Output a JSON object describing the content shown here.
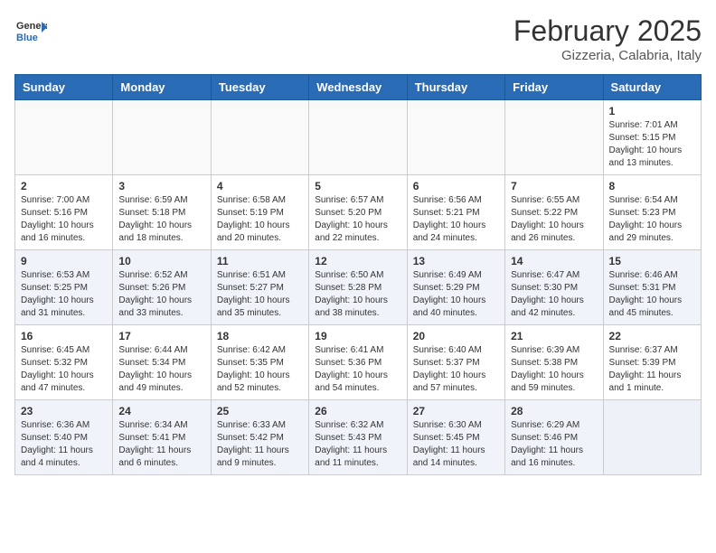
{
  "header": {
    "logo_general": "General",
    "logo_blue": "Blue",
    "month_year": "February 2025",
    "location": "Gizzeria, Calabria, Italy"
  },
  "weekdays": [
    "Sunday",
    "Monday",
    "Tuesday",
    "Wednesday",
    "Thursday",
    "Friday",
    "Saturday"
  ],
  "weeks": [
    {
      "shaded": false,
      "days": [
        {
          "num": "",
          "info": ""
        },
        {
          "num": "",
          "info": ""
        },
        {
          "num": "",
          "info": ""
        },
        {
          "num": "",
          "info": ""
        },
        {
          "num": "",
          "info": ""
        },
        {
          "num": "",
          "info": ""
        },
        {
          "num": "1",
          "info": "Sunrise: 7:01 AM\nSunset: 5:15 PM\nDaylight: 10 hours\nand 13 minutes."
        }
      ]
    },
    {
      "shaded": false,
      "days": [
        {
          "num": "2",
          "info": "Sunrise: 7:00 AM\nSunset: 5:16 PM\nDaylight: 10 hours\nand 16 minutes."
        },
        {
          "num": "3",
          "info": "Sunrise: 6:59 AM\nSunset: 5:18 PM\nDaylight: 10 hours\nand 18 minutes."
        },
        {
          "num": "4",
          "info": "Sunrise: 6:58 AM\nSunset: 5:19 PM\nDaylight: 10 hours\nand 20 minutes."
        },
        {
          "num": "5",
          "info": "Sunrise: 6:57 AM\nSunset: 5:20 PM\nDaylight: 10 hours\nand 22 minutes."
        },
        {
          "num": "6",
          "info": "Sunrise: 6:56 AM\nSunset: 5:21 PM\nDaylight: 10 hours\nand 24 minutes."
        },
        {
          "num": "7",
          "info": "Sunrise: 6:55 AM\nSunset: 5:22 PM\nDaylight: 10 hours\nand 26 minutes."
        },
        {
          "num": "8",
          "info": "Sunrise: 6:54 AM\nSunset: 5:23 PM\nDaylight: 10 hours\nand 29 minutes."
        }
      ]
    },
    {
      "shaded": true,
      "days": [
        {
          "num": "9",
          "info": "Sunrise: 6:53 AM\nSunset: 5:25 PM\nDaylight: 10 hours\nand 31 minutes."
        },
        {
          "num": "10",
          "info": "Sunrise: 6:52 AM\nSunset: 5:26 PM\nDaylight: 10 hours\nand 33 minutes."
        },
        {
          "num": "11",
          "info": "Sunrise: 6:51 AM\nSunset: 5:27 PM\nDaylight: 10 hours\nand 35 minutes."
        },
        {
          "num": "12",
          "info": "Sunrise: 6:50 AM\nSunset: 5:28 PM\nDaylight: 10 hours\nand 38 minutes."
        },
        {
          "num": "13",
          "info": "Sunrise: 6:49 AM\nSunset: 5:29 PM\nDaylight: 10 hours\nand 40 minutes."
        },
        {
          "num": "14",
          "info": "Sunrise: 6:47 AM\nSunset: 5:30 PM\nDaylight: 10 hours\nand 42 minutes."
        },
        {
          "num": "15",
          "info": "Sunrise: 6:46 AM\nSunset: 5:31 PM\nDaylight: 10 hours\nand 45 minutes."
        }
      ]
    },
    {
      "shaded": false,
      "days": [
        {
          "num": "16",
          "info": "Sunrise: 6:45 AM\nSunset: 5:32 PM\nDaylight: 10 hours\nand 47 minutes."
        },
        {
          "num": "17",
          "info": "Sunrise: 6:44 AM\nSunset: 5:34 PM\nDaylight: 10 hours\nand 49 minutes."
        },
        {
          "num": "18",
          "info": "Sunrise: 6:42 AM\nSunset: 5:35 PM\nDaylight: 10 hours\nand 52 minutes."
        },
        {
          "num": "19",
          "info": "Sunrise: 6:41 AM\nSunset: 5:36 PM\nDaylight: 10 hours\nand 54 minutes."
        },
        {
          "num": "20",
          "info": "Sunrise: 6:40 AM\nSunset: 5:37 PM\nDaylight: 10 hours\nand 57 minutes."
        },
        {
          "num": "21",
          "info": "Sunrise: 6:39 AM\nSunset: 5:38 PM\nDaylight: 10 hours\nand 59 minutes."
        },
        {
          "num": "22",
          "info": "Sunrise: 6:37 AM\nSunset: 5:39 PM\nDaylight: 11 hours\nand 1 minute."
        }
      ]
    },
    {
      "shaded": true,
      "days": [
        {
          "num": "23",
          "info": "Sunrise: 6:36 AM\nSunset: 5:40 PM\nDaylight: 11 hours\nand 4 minutes."
        },
        {
          "num": "24",
          "info": "Sunrise: 6:34 AM\nSunset: 5:41 PM\nDaylight: 11 hours\nand 6 minutes."
        },
        {
          "num": "25",
          "info": "Sunrise: 6:33 AM\nSunset: 5:42 PM\nDaylight: 11 hours\nand 9 minutes."
        },
        {
          "num": "26",
          "info": "Sunrise: 6:32 AM\nSunset: 5:43 PM\nDaylight: 11 hours\nand 11 minutes."
        },
        {
          "num": "27",
          "info": "Sunrise: 6:30 AM\nSunset: 5:45 PM\nDaylight: 11 hours\nand 14 minutes."
        },
        {
          "num": "28",
          "info": "Sunrise: 6:29 AM\nSunset: 5:46 PM\nDaylight: 11 hours\nand 16 minutes."
        },
        {
          "num": "",
          "info": ""
        }
      ]
    }
  ]
}
